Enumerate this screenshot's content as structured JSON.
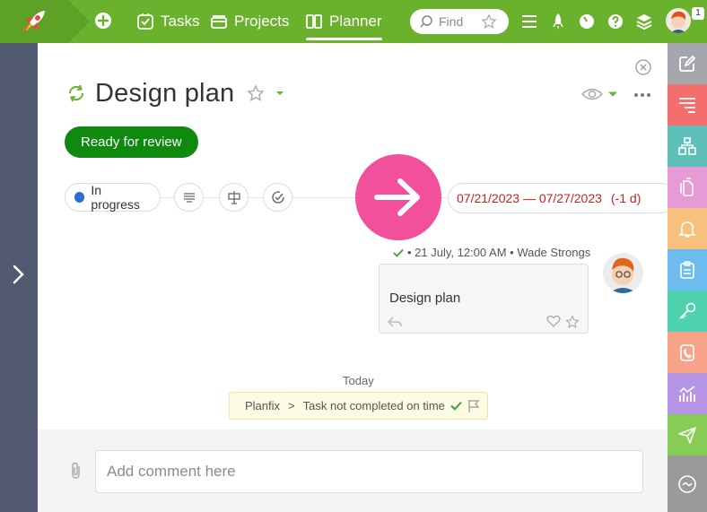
{
  "topbar": {
    "nav": [
      {
        "label": "Tasks",
        "icon": "tasks-icon"
      },
      {
        "label": "Projects",
        "icon": "projects-icon"
      },
      {
        "label": "Planner",
        "icon": "planner-icon",
        "active": true
      }
    ],
    "search": {
      "placeholder": "Find"
    },
    "notification_count": "1",
    "colors": {
      "bar": "#6ab22e",
      "logo_zone": "#5da127"
    }
  },
  "task": {
    "title": "Design plan",
    "status_button": "Ready for review",
    "state": "In progress",
    "date_range": "07/21/2023 — 07/27/2023",
    "overdue": "(-1 d)",
    "colors": {
      "status_button": "#0f8a0f",
      "state_dot": "#2c6fd6",
      "date": "#d02020",
      "arrow": "#f2509b"
    }
  },
  "comment": {
    "meta": "• 21 July, 12:00  AM • Wade Strongs",
    "text": "Design plan"
  },
  "history": {
    "day": "Today",
    "source": "Planfix",
    "separator": ">",
    "event": "Task not completed on time"
  },
  "composer": {
    "placeholder": "Add comment here"
  },
  "right_sidebar": [
    {
      "name": "edit-icon",
      "color": "#a5a7ad"
    },
    {
      "name": "list-icon",
      "color": "#f46e6e"
    },
    {
      "name": "structure-icon",
      "color": "#5fbfb9"
    },
    {
      "name": "documents-icon",
      "color": "#e69bd6"
    },
    {
      "name": "bell-icon",
      "color": "#f7c07c"
    },
    {
      "name": "clipboard-icon",
      "color": "#6dbcf0"
    },
    {
      "name": "key-icon",
      "color": "#4fd2ae"
    },
    {
      "name": "contacts-icon",
      "color": "#f6a38a"
    },
    {
      "name": "analytics-icon",
      "color": "#b795e6"
    },
    {
      "name": "send-icon",
      "color": "#86cc55"
    },
    {
      "name": "smile-icon",
      "color": "#9a9a9a"
    }
  ]
}
